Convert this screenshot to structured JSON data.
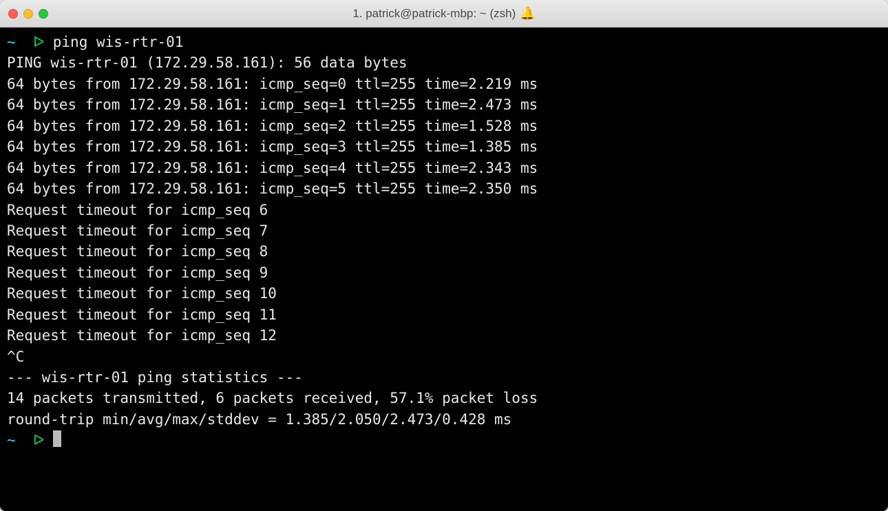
{
  "window": {
    "title": "1. patrick@patrick-mbp: ~ (zsh)",
    "bell_icon": "🔔"
  },
  "terminal": {
    "prompt_cwd": "~",
    "prompt_symbol": "ᐅ",
    "command": "ping wis-rtr-01",
    "lines": [
      "PING wis-rtr-01 (172.29.58.161): 56 data bytes",
      "64 bytes from 172.29.58.161: icmp_seq=0 ttl=255 time=2.219 ms",
      "64 bytes from 172.29.58.161: icmp_seq=1 ttl=255 time=2.473 ms",
      "64 bytes from 172.29.58.161: icmp_seq=2 ttl=255 time=1.528 ms",
      "64 bytes from 172.29.58.161: icmp_seq=3 ttl=255 time=1.385 ms",
      "64 bytes from 172.29.58.161: icmp_seq=4 ttl=255 time=2.343 ms",
      "64 bytes from 172.29.58.161: icmp_seq=5 ttl=255 time=2.350 ms",
      "Request timeout for icmp_seq 6",
      "Request timeout for icmp_seq 7",
      "Request timeout for icmp_seq 8",
      "Request timeout for icmp_seq 9",
      "Request timeout for icmp_seq 10",
      "Request timeout for icmp_seq 11",
      "Request timeout for icmp_seq 12",
      "^C",
      "--- wis-rtr-01 ping statistics ---",
      "14 packets transmitted, 6 packets received, 57.1% packet loss",
      "round-trip min/avg/max/stddev = 1.385/2.050/2.473/0.428 ms"
    ]
  }
}
